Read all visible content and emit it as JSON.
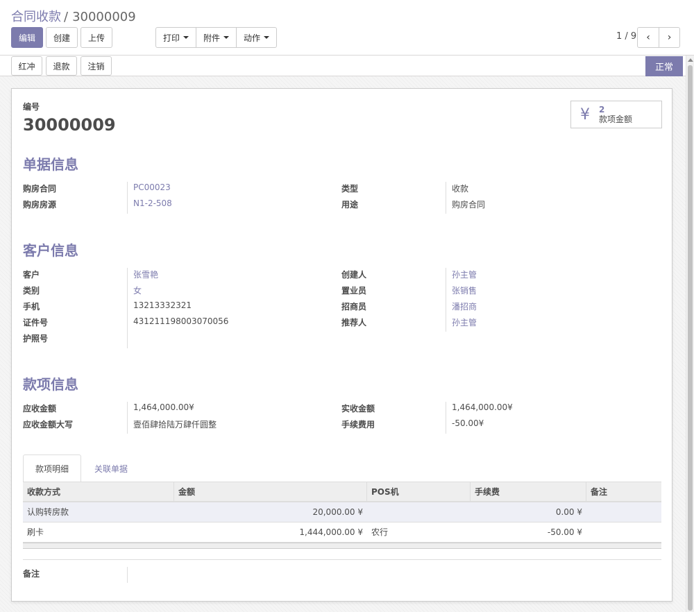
{
  "breadcrumb": {
    "parent": "合同收款",
    "separator": "/",
    "current": "30000009"
  },
  "toolbar": {
    "edit": "编辑",
    "create": "创建",
    "upload": "上传",
    "print": "打印",
    "attachment": "附件",
    "action": "动作"
  },
  "pager": {
    "value": "1 / 9",
    "prev": "‹",
    "next": "›"
  },
  "statusbar": {
    "red_reverse": "红冲",
    "refund": "退款",
    "cancel": "注销",
    "state": "正常"
  },
  "sheet": {
    "number_label": "编号",
    "number": "30000009",
    "stat": {
      "icon": "yen-icon",
      "symbol": "¥",
      "value": "2",
      "label": "款项金额"
    }
  },
  "doc_info": {
    "title": "单据信息",
    "fields": [
      {
        "label": "购房合同",
        "value": "PC00023",
        "link": true
      },
      {
        "label": "购房房源",
        "value": "N1-2-508",
        "link": true
      },
      {
        "label": "类型",
        "value": "收款",
        "link": false
      },
      {
        "label": "用途",
        "value": "购房合同",
        "link": false
      }
    ]
  },
  "customer_info": {
    "title": "客户信息",
    "fields": [
      {
        "label": "客户",
        "value": "张雪艳",
        "link": true
      },
      {
        "label": "类别",
        "value": "女",
        "link": true
      },
      {
        "label": "手机",
        "value": "13213332321",
        "link": false
      },
      {
        "label": "证件号",
        "value": "431211198003070056",
        "link": false
      },
      {
        "label": "护照号",
        "value": "",
        "link": false
      },
      {
        "label": "创建人",
        "value": "孙主管",
        "link": true
      },
      {
        "label": "置业员",
        "value": "张销售",
        "link": true
      },
      {
        "label": "招商员",
        "value": "潘招商",
        "link": true
      },
      {
        "label": "推荐人",
        "value": "孙主管",
        "link": true
      }
    ]
  },
  "payment_info": {
    "title": "款项信息",
    "fields": [
      {
        "label": "应收金额",
        "value": "1,464,000.00¥"
      },
      {
        "label": "应收金额大写",
        "value": "壹佰肆拾陆万肆仟圆整"
      },
      {
        "label": "实收金额",
        "value": "1,464,000.00¥"
      },
      {
        "label": "手续费用",
        "value": "-50.00¥"
      }
    ]
  },
  "tabs": [
    {
      "label": "款项明细",
      "active": true
    },
    {
      "label": "关联单据",
      "active": false
    }
  ],
  "table": {
    "columns": [
      "收款方式",
      "金额",
      "POS机",
      "手续费",
      "备注"
    ],
    "rows": [
      [
        "认购转房款",
        "20,000.00 ¥",
        "",
        "0.00 ¥",
        ""
      ],
      [
        "刷卡",
        "1,444,000.00 ¥",
        "农行",
        "-50.00 ¥",
        ""
      ]
    ]
  },
  "notes": {
    "label": "备注",
    "value": ""
  },
  "colors": {
    "accent": "#7c7bad",
    "row_highlight": "#eeeff6"
  }
}
